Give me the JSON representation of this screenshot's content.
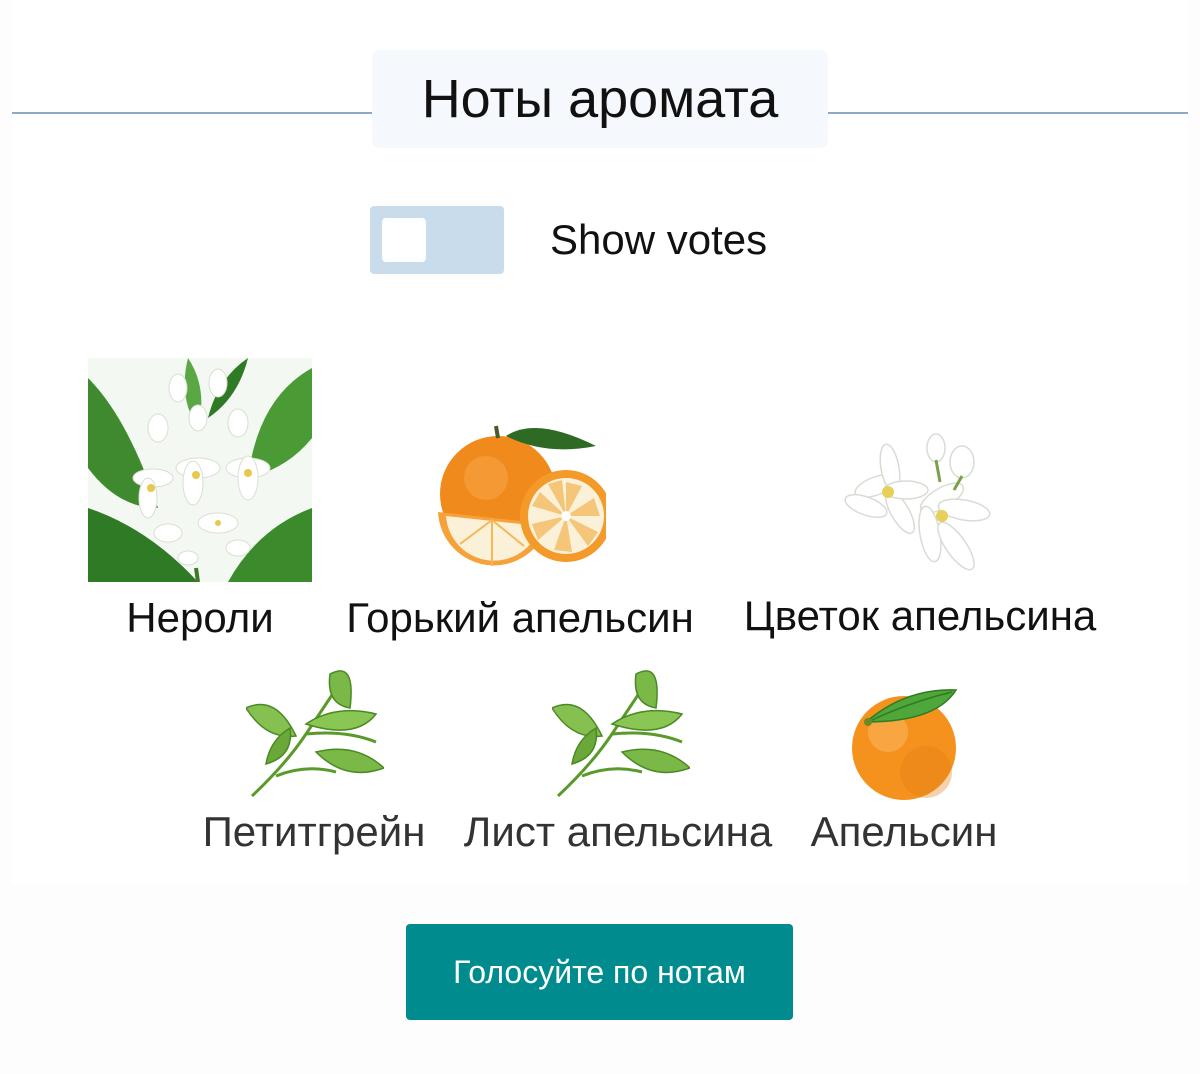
{
  "section": {
    "title": "Ноты аромата"
  },
  "votes_toggle": {
    "label": "Show votes",
    "state": "off"
  },
  "notes": [
    {
      "name": "Нероли",
      "icon": "neroli-flowers-image"
    },
    {
      "name": "Горький апельсин",
      "icon": "bitter-orange-image"
    },
    {
      "name": "Цветок апельсина",
      "icon": "orange-blossom-image"
    },
    {
      "name": "Петитгрейн",
      "icon": "petitgrain-leaves-image"
    },
    {
      "name": "Лист апельсина",
      "icon": "orange-leaf-image"
    },
    {
      "name": "Апельсин",
      "icon": "orange-image"
    }
  ],
  "vote_button": {
    "label": "Голосуйте по нотам"
  },
  "colors": {
    "accent": "#008b8f",
    "toggle_bg": "#c9dcec",
    "header_line": "#8fa9c4"
  }
}
